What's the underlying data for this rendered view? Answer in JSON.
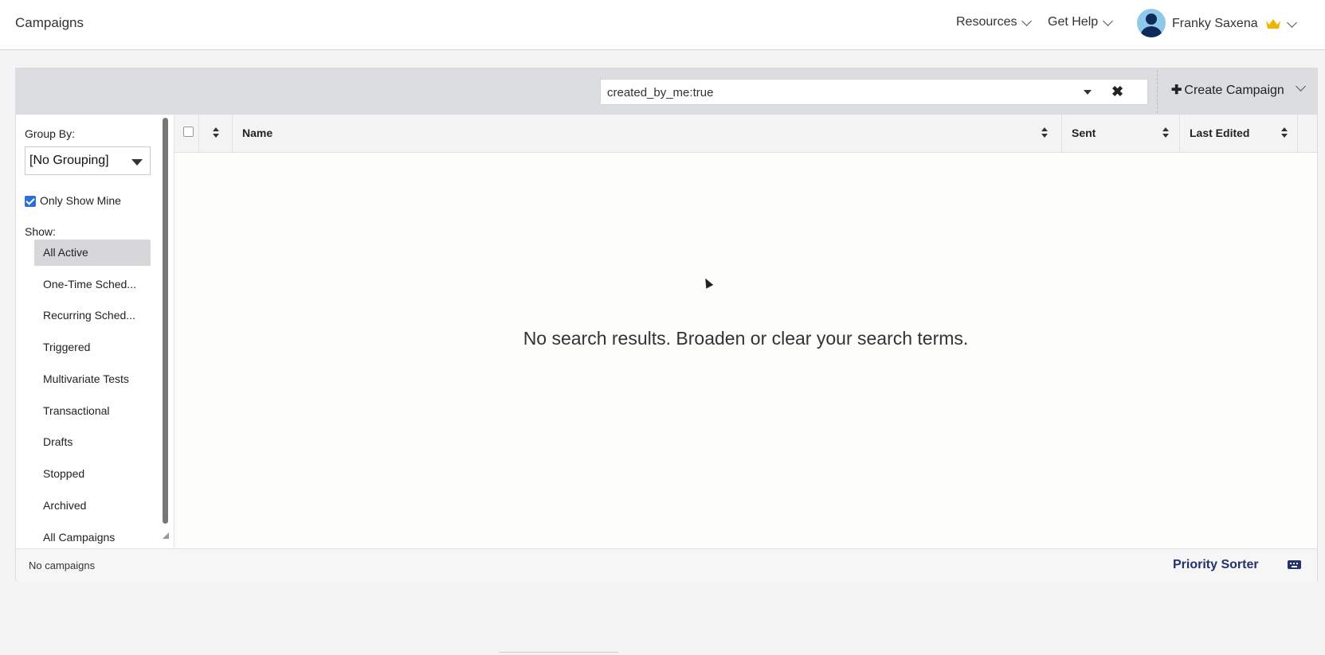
{
  "header": {
    "title": "Campaigns",
    "nav": [
      {
        "label": "Resources"
      },
      {
        "label": "Get Help"
      }
    ],
    "user": {
      "name": "Franky Saxena",
      "badge_icon": "crown-icon"
    }
  },
  "toolbar": {
    "search_value": "created_by_me:true",
    "create_label": "Create Campaign"
  },
  "sidebar": {
    "group_by_label": "Group By:",
    "group_by_value": "[No Grouping]",
    "only_show_mine_label": "Only Show Mine",
    "only_show_mine_checked": true,
    "show_label": "Show:",
    "items": [
      {
        "label": "All Active",
        "active": true
      },
      {
        "label": "One-Time Sched..."
      },
      {
        "label": "Recurring Sched..."
      },
      {
        "label": "Triggered"
      },
      {
        "label": "Multivariate Tests"
      },
      {
        "label": "Transactional"
      },
      {
        "label": "Drafts"
      },
      {
        "label": "Stopped"
      },
      {
        "label": "Archived"
      },
      {
        "label": "All Campaigns"
      }
    ]
  },
  "table": {
    "columns": [
      {
        "label": "Name"
      },
      {
        "label": "Sent"
      },
      {
        "label": "Last Edited"
      }
    ],
    "empty_message": "No search results. Broaden or clear your search terms."
  },
  "footer": {
    "count_text": "No campaigns",
    "priority_label": "Priority Sorter"
  },
  "colors": {
    "accent": "#24336b",
    "checkbox": "#2c6fd6",
    "toolbar_bg": "#dcdde0",
    "crown": "#f0b400"
  }
}
